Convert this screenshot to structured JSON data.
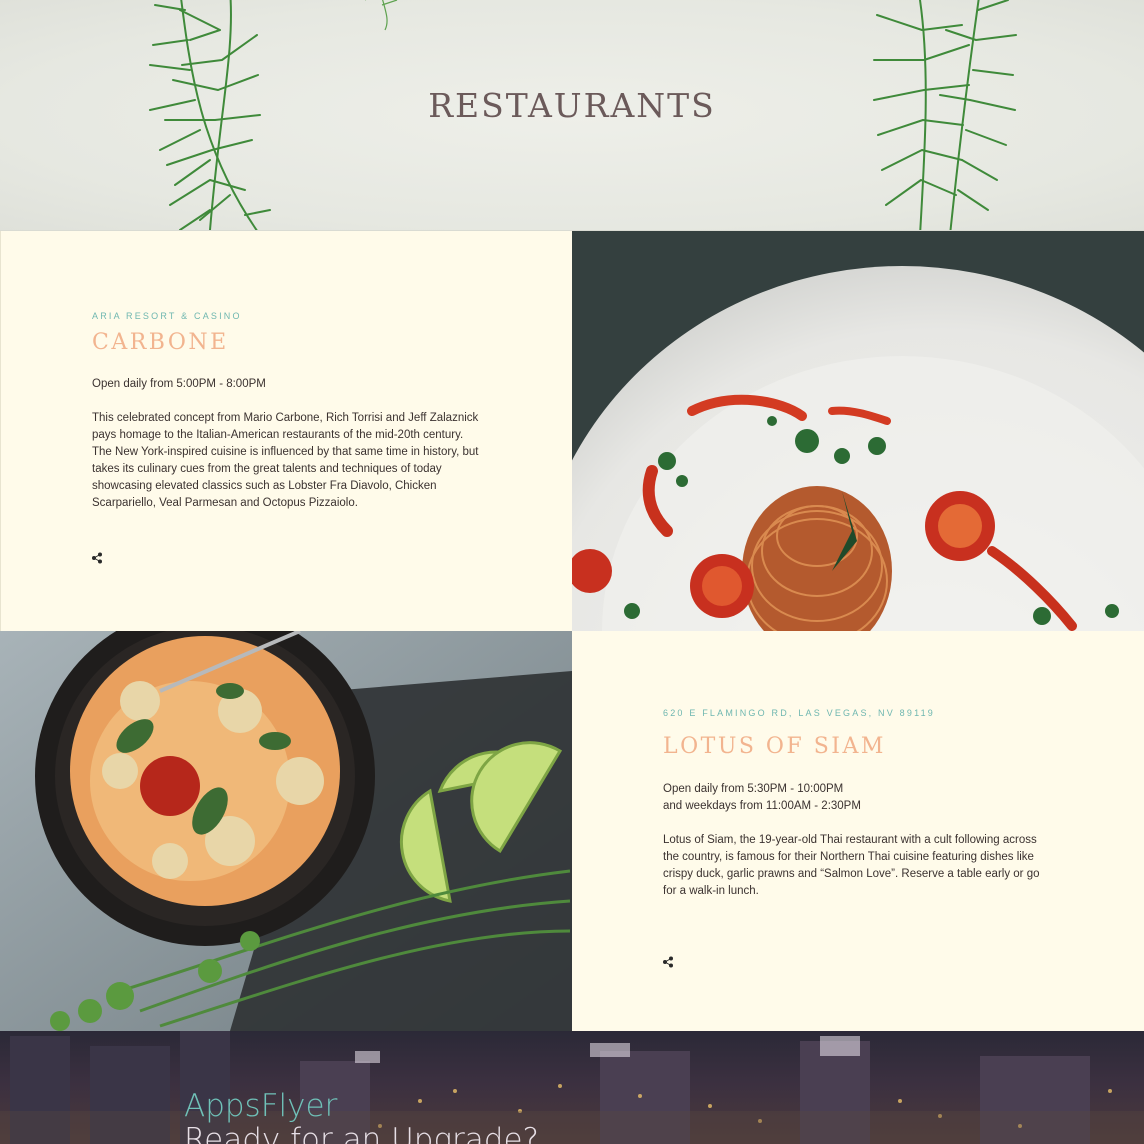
{
  "hero": {
    "title": "RESTAURANTS"
  },
  "restaurants": [
    {
      "eyebrow": "ARIA RESORT & CASINO",
      "name": "CARBONE",
      "hours": [
        "Open daily from 5:00PM - 8:00PM"
      ],
      "description": "This celebrated concept from Mario Carbone, Rich Torrisi and Jeff Zalaznick pays homage to the Italian-American restaurants of the mid-20th century. The New York-inspired cuisine is influenced by that same time in history, but takes its culinary cues from the great talents and techniques of today showcasing elevated classics such as Lobster Fra Diavolo, Chicken Scarpariello, Veal Parmesan and Octopus Pizzaiolo.",
      "share_icon": "share-icon"
    },
    {
      "eyebrow": "620 E FLAMINGO RD, LAS VEGAS, NV 89119",
      "name": "LOTUS OF SIAM",
      "hours": [
        "Open daily from 5:30PM - 10:00PM",
        "and weekdays from 11:00AM - 2:30PM"
      ],
      "description": "Lotus of Siam, the 19-year-old Thai restaurant with a cult following across the country, is famous for their Northern Thai cuisine featuring dishes like crispy duck, garlic prawns and “Salmon Love”. Reserve a table early or go for a walk-in lunch.",
      "share_icon": "share-icon"
    }
  ],
  "banner": {
    "brand": "AppsFlyer",
    "headline": "Ready for an Upgrade?"
  },
  "colors": {
    "background": "#fffbea",
    "eyebrow": "#6fb7b0",
    "restaurant_name": "#f2b48f",
    "body_text": "#3b3230",
    "brand": "#6fc1b8"
  }
}
